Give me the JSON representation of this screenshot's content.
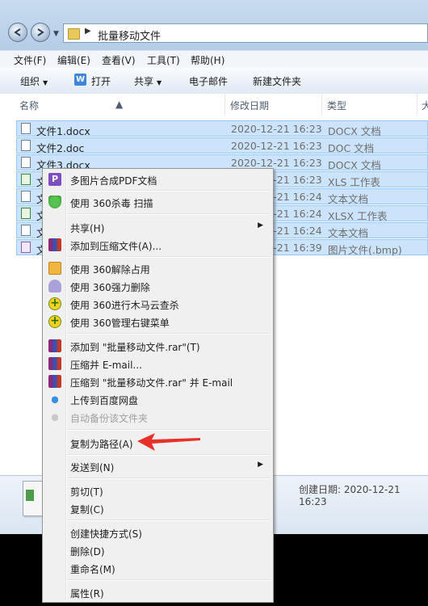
{
  "address": {
    "path": "批量移动文件"
  },
  "menubar": [
    "文件(F)",
    "编辑(E)",
    "查看(V)",
    "工具(T)",
    "帮助(H)"
  ],
  "toolbar": {
    "organize": "组织",
    "open": "打开",
    "share": "共享",
    "email": "电子邮件",
    "newfolder": "新建文件夹"
  },
  "columns": {
    "name": "名称",
    "date": "修改日期",
    "type": "类型",
    "size": "大"
  },
  "files": [
    {
      "name": "文件1.docx",
      "date": "2020-12-21 16:23",
      "type": "DOCX 文档"
    },
    {
      "name": "文件2.doc",
      "date": "2020-12-21 16:23",
      "type": "DOC 文档"
    },
    {
      "name": "文件3.docx",
      "date": "2020-12-21 16:23",
      "type": "DOCX 文档"
    },
    {
      "name": "文",
      "date": "2020-12-21 16:23",
      "type": "XLS 工作表"
    },
    {
      "name": "文",
      "date": "2020-12-21 16:24",
      "type": "文本文档"
    },
    {
      "name": "文",
      "date": "2020-12-21 16:24",
      "type": "XLSX 工作表"
    },
    {
      "name": "文",
      "date": "2020-12-21 16:24",
      "type": "文本文档"
    },
    {
      "name": "文",
      "date": "2020-12-21 16:39",
      "type": "图片文件(.bmp)"
    }
  ],
  "details": {
    "created": "创建日期: 2020-12-21 16:23"
  },
  "context_menu": {
    "items": [
      "多图片合成PDF文档",
      "使用 360杀毒 扫描",
      "共享(H)",
      "添加到压缩文件(A)...",
      "使用 360解除占用",
      "使用 360强力删除",
      "使用 360进行木马云查杀",
      "使用 360管理右键菜单",
      "添加到 \"批量移动文件.rar\"(T)",
      "压缩并 E-mail...",
      "压缩到 \"批量移动文件.rar\" 并 E-mail",
      "上传到百度网盘",
      "自动备份该文件夹",
      "复制为路径(A)",
      "发送到(N)",
      "剪切(T)",
      "复制(C)",
      "创建快捷方式(S)",
      "删除(D)",
      "重命名(M)",
      "属性(R)"
    ]
  },
  "colors": {
    "selection": "#cce4fb",
    "annotation_arrow": "#e8302a"
  }
}
